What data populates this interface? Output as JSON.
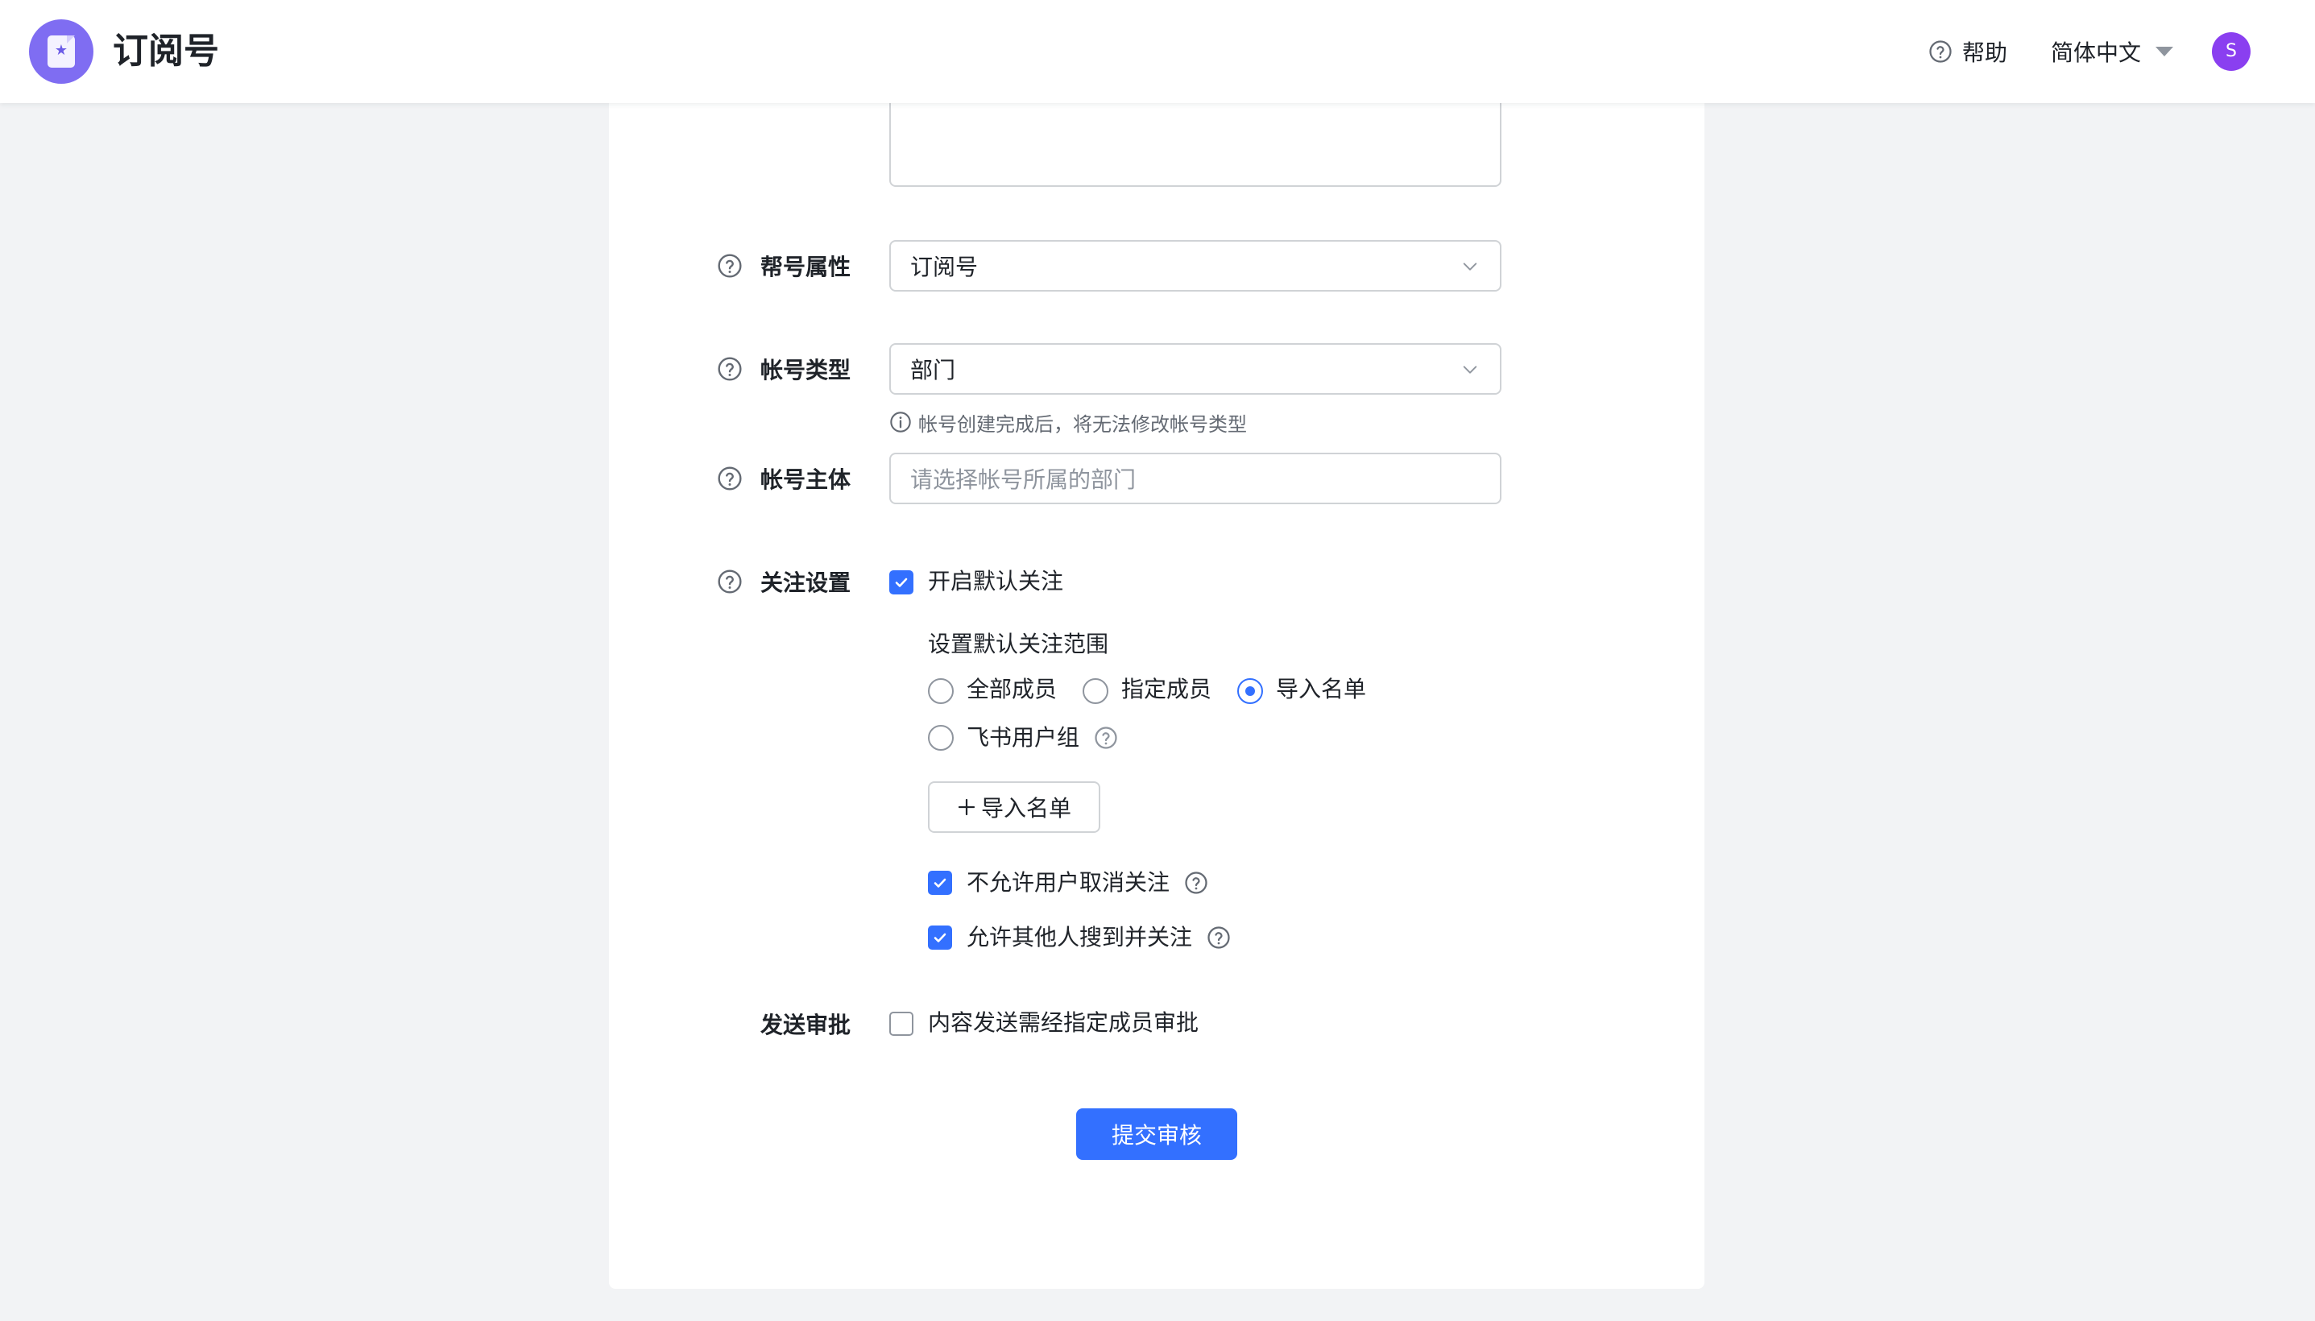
{
  "header": {
    "app_icon": "subscription-account-logo-icon",
    "title": "订阅号",
    "help_icon": "question-circle-icon",
    "help_label": "帮助",
    "language_label": "简体中文",
    "language_icon": "caret-down-icon",
    "avatar_initial": "S",
    "avatar_color": "#8a3ff0"
  },
  "form": {
    "account_attribute": {
      "label": "帮号属性",
      "value": "订阅号"
    },
    "account_type": {
      "label": "帐号类型",
      "value": "部门",
      "hint": "帐号创建完成后，将无法修改帐号类型"
    },
    "account_owner": {
      "label": "帐号主体",
      "placeholder": "请选择帐号所属的部门"
    },
    "follow_settings": {
      "label": "关注设置",
      "default_follow_label": "开启默认关注",
      "default_follow_checked": true,
      "scope_title": "设置默认关注范围",
      "scope_options": [
        {
          "label": "全部成员",
          "selected": false
        },
        {
          "label": "指定成员",
          "selected": false
        },
        {
          "label": "导入名单",
          "selected": true
        },
        {
          "label": "飞书用户组",
          "selected": false
        }
      ],
      "import_button_label": "导入名单",
      "disallow_unfollow_label": "不允许用户取消关注",
      "disallow_unfollow_checked": true,
      "allow_search_label": "允许其他人搜到并关注",
      "allow_search_checked": true
    },
    "send_approval": {
      "label": "发送审批",
      "option_label": "内容发送需经指定成员审批",
      "checked": false
    },
    "submit_label": "提交审核"
  },
  "colors": {
    "primary": "#3370ff",
    "page_background": "#f2f3f5",
    "logo": "#7f6df2"
  }
}
